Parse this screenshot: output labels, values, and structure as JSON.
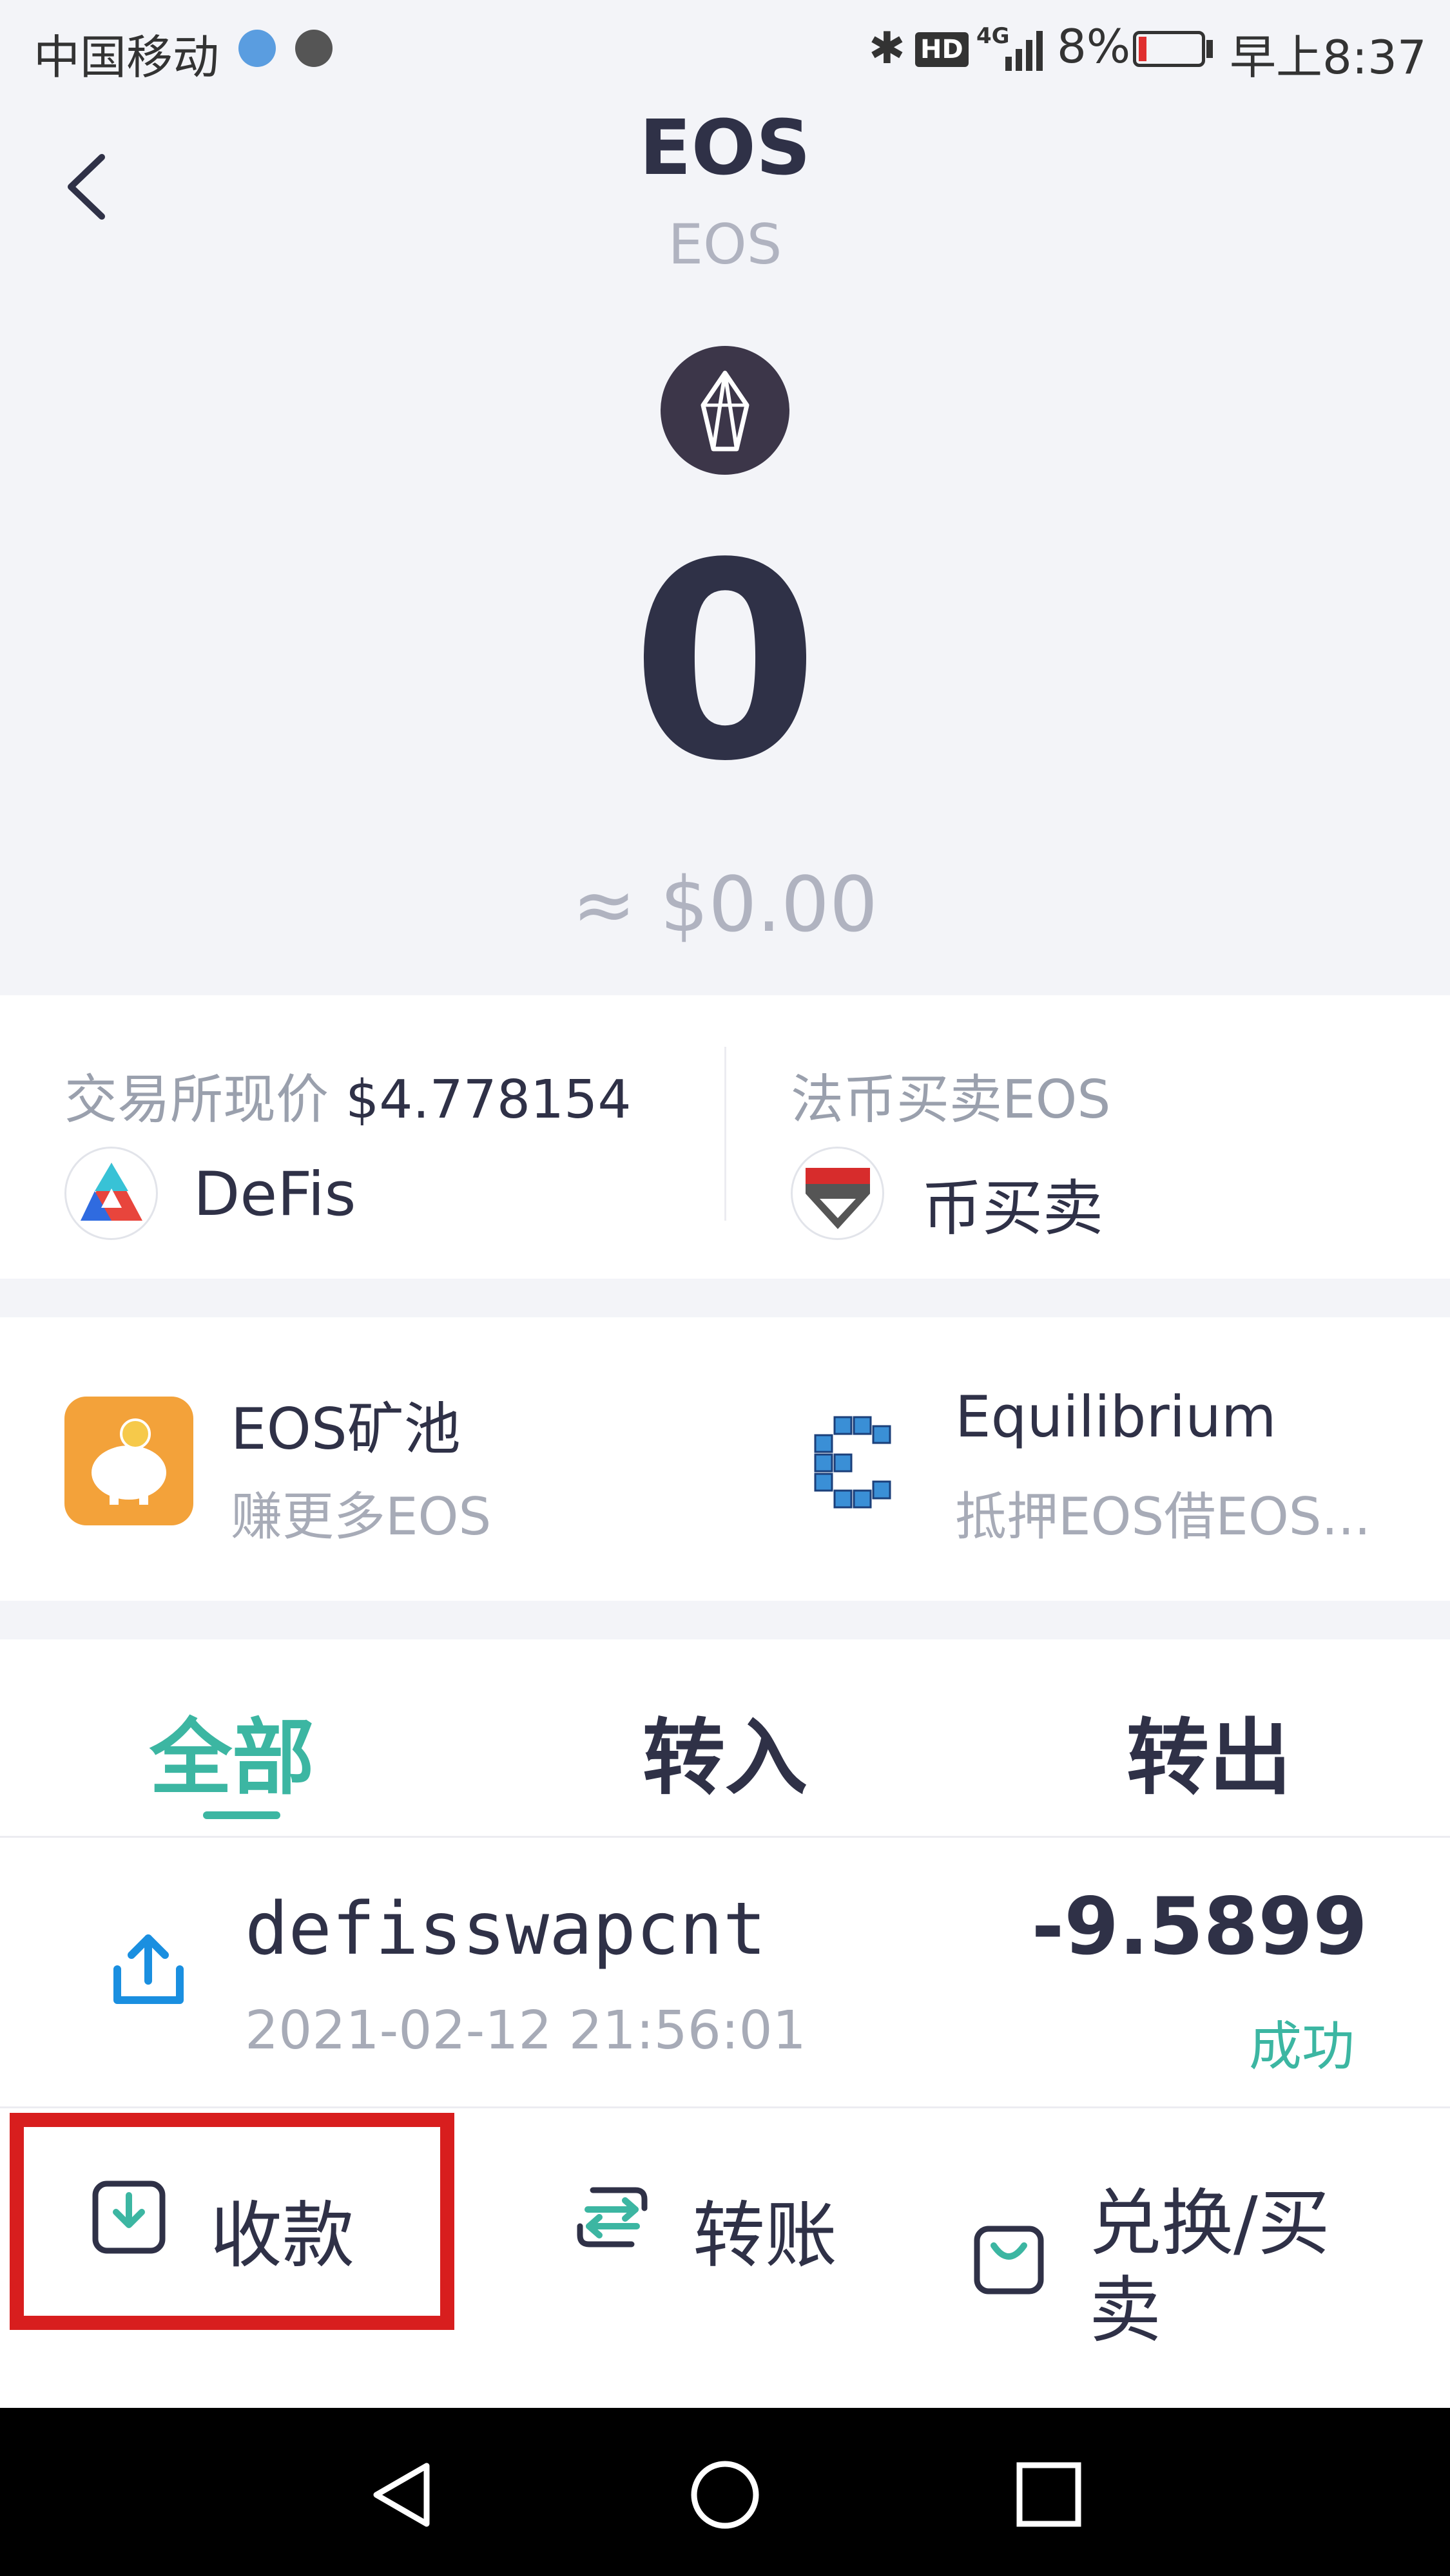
{
  "status_bar": {
    "carrier": "中国移动",
    "network": "4G",
    "hd": "HD",
    "battery": "8%",
    "time": "早上8:37"
  },
  "header": {
    "title": "EOS",
    "subtitle": "EOS",
    "balance": "0",
    "fiat_value": "≈ $0.00"
  },
  "market": {
    "exchange_label": "交易所现价",
    "exchange_price": "$4.778154",
    "exchange_name": "DeFis",
    "fiat_label": "法币买卖EOS",
    "fiat_name": "币买卖"
  },
  "dapps": [
    {
      "title": "EOS矿池",
      "subtitle": "赚更多EOS"
    },
    {
      "title": "Equilibrium",
      "subtitle": "抵押EOS借EOS..."
    }
  ],
  "tabs": [
    {
      "label": "全部",
      "active": true
    },
    {
      "label": "转入",
      "active": false
    },
    {
      "label": "转出",
      "active": false
    }
  ],
  "transactions": [
    {
      "name": "defisswapcnt",
      "date": "2021-02-12 21:56:01",
      "amount": "-9.5899",
      "status": "成功"
    }
  ],
  "actions": {
    "receive": "收款",
    "transfer": "转账",
    "exchange": "兑换/买卖"
  },
  "colors": {
    "accent": "#3cb6a2",
    "text": "#2f3147",
    "muted": "#b0b3c0",
    "highlight": "#d81e1e",
    "background": "#f3f4f8",
    "tx_icon": "#1a8fe0"
  },
  "icons": {
    "back": "chevron-left-icon",
    "coin_logo": "eos-logo-icon",
    "tx_out": "upload-icon",
    "receive": "download-icon",
    "transfer": "swap-icon",
    "exchange": "shopping-bag-icon"
  }
}
